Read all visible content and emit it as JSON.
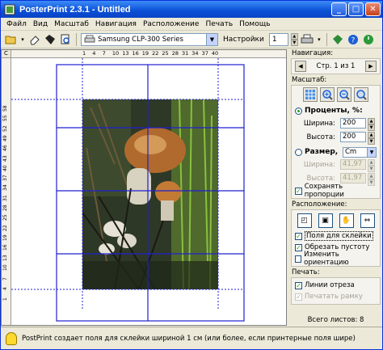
{
  "window": {
    "title": "PosterPrint 2.3.1 - Untitled",
    "minimize": "_",
    "maximize": "□",
    "close": "✕"
  },
  "menu": [
    "Файл",
    "Вид",
    "Масштаб",
    "Навигация",
    "Расположение",
    "Печать",
    "Помощь"
  ],
  "toolbar": {
    "printer": "Samsung CLP-300 Series",
    "settings_label": "Настройки",
    "copies": "1",
    "icons": [
      "open-folder-icon",
      "dropdown-arrow-icon",
      "eraser-icon",
      "save-icon",
      "print-preview-icon",
      "printer-icon",
      "web-icon",
      "help-icon",
      "power-icon"
    ]
  },
  "rulers": {
    "corner": "С",
    "horizontal_ticks": [
      "1",
      "4",
      "7",
      "10",
      "13",
      "16",
      "19",
      "22",
      "25",
      "28",
      "31",
      "34",
      "37",
      "40"
    ],
    "vertical_ticks": [
      "58",
      "55",
      "52",
      "49",
      "46",
      "43",
      "40",
      "37",
      "34",
      "31",
      "28",
      "25",
      "22",
      "19",
      "16",
      "13",
      "10",
      "7",
      "4",
      "1"
    ]
  },
  "panel": {
    "navigation": {
      "title": "Навигация:",
      "page_text": "Стр. 1 из 1"
    },
    "scale": {
      "title": "Масштаб:",
      "percent_label": "Проценты, %:",
      "width_label": "Ширина:",
      "width_value": "200",
      "height_label": "Высота:",
      "height_value": "200",
      "size_label": "Размер,",
      "unit": "Cm",
      "size_width_label": "Ширина:",
      "size_width_value": "41,97",
      "size_height_label": "Высота:",
      "size_height_value": "41,97",
      "keep_proportions": "Сохранять пропорции"
    },
    "layout": {
      "title": "Расположение:",
      "glue_margins": "Поля для склейки",
      "trim_empty": "Обрезать пустоту",
      "change_orientation": "Изменить ориентацию"
    },
    "print": {
      "title": "Печать:",
      "cut_lines": "Линии отреза",
      "print_frame": "Печатать рамку"
    },
    "total_sheets": "Всего листов: 8"
  },
  "status": {
    "text": "PostPrint создает поля для склейки шириной 1 см (или более, если принтерные поля шире)"
  },
  "colors": {
    "titlebar": "#0a4fd6",
    "grid_line": "#2020d0",
    "panel_bg": "#ece9d8"
  }
}
